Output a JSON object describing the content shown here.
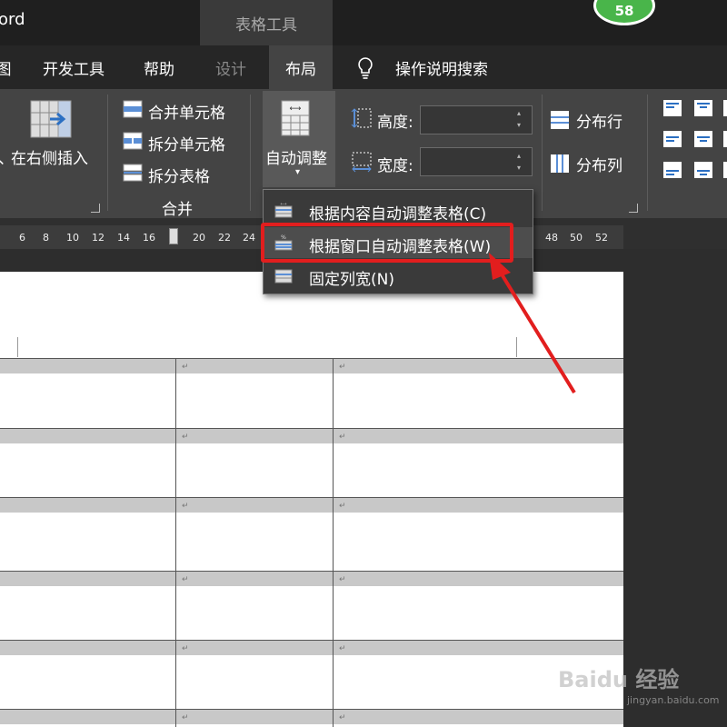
{
  "title_bar": {
    "app_name": "ord",
    "context_tab_group": "表格工具",
    "badge": "58"
  },
  "menu": {
    "tabs": [
      {
        "label": "图"
      },
      {
        "label": "开发工具"
      },
      {
        "label": "帮助"
      },
      {
        "label": "设计"
      },
      {
        "label": "布局"
      },
      {
        "label": "操作说明搜索"
      }
    ]
  },
  "ribbon": {
    "insert_right_label": "在右侧插入",
    "insert_left_fragment": "、",
    "merge": {
      "merge_cells": "合并单元格",
      "split_cells": "拆分单元格",
      "split_table": "拆分表格",
      "group_label": "合并"
    },
    "autofit_label": "自动调整",
    "cell_size": {
      "height_label": "高度:",
      "width_label": "宽度:",
      "height_value": "",
      "width_value": ""
    },
    "distribute_rows": "分布行",
    "distribute_cols": "分布列"
  },
  "ruler": {
    "ticks": [
      "6",
      "8",
      "10",
      "12",
      "14",
      "16",
      "20",
      "22",
      "24",
      "48",
      "50",
      "52"
    ]
  },
  "dropdown": {
    "items": [
      {
        "label": "根据内容自动调整表格(C)"
      },
      {
        "label": "根据窗口自动调整表格(W)"
      },
      {
        "label": "固定列宽(N)"
      }
    ]
  },
  "document": {
    "cell_mark": "↵"
  },
  "watermark": {
    "brand": "Baidu 经验",
    "url": "jingyan.baidu.com"
  },
  "colors": {
    "highlight": "#e21e1e",
    "badge": "#49b54a",
    "arrow": "#e21e1e"
  }
}
